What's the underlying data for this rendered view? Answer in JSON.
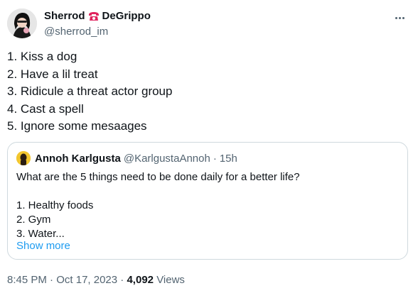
{
  "author": {
    "name_first": "Sherrod",
    "name_last": "DeGrippo",
    "handle": "@sherrod_im"
  },
  "tweet": {
    "lines": [
      "1. Kiss a dog",
      "2. Have a lil treat",
      "3. Ridicule a threat actor group",
      "4. Cast a spell",
      "5. Ignore some mesaages"
    ]
  },
  "quote": {
    "name": "Annoh Karlgusta",
    "handle": "@KarlgustaAnnoh",
    "separator": "·",
    "time": "15h",
    "lines": [
      "What are the 5 things need to be done daily for a better life?",
      "",
      "1. Healthy foods",
      "2. Gym",
      "3. Water..."
    ],
    "show_more": "Show more"
  },
  "meta": {
    "time": "8:45 PM",
    "separator": "·",
    "date": "Oct 17, 2023",
    "views_count": "4,092",
    "views_label": "Views"
  },
  "colors": {
    "primary_text": "#0f1419",
    "secondary_text": "#536471",
    "link": "#1d9bf0",
    "border": "#cfd9de",
    "phone_icon": "#e0245e"
  },
  "icons": {
    "more": "more-horizontal-icon",
    "phone": "telephone-icon"
  }
}
